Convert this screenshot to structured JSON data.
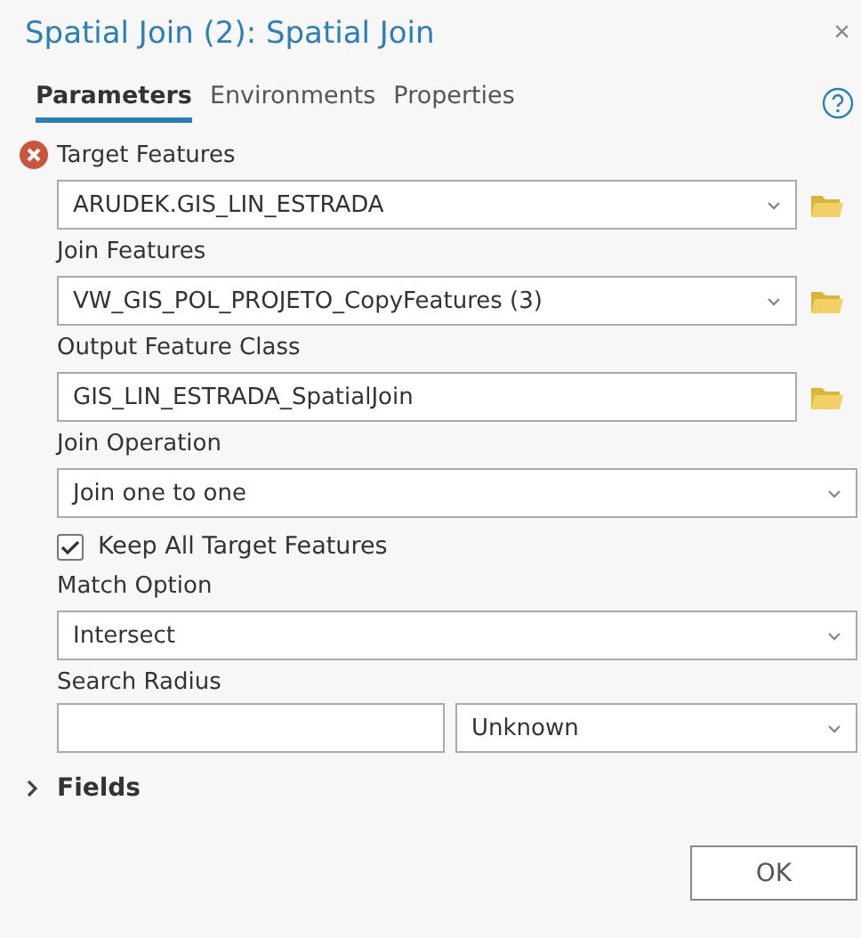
{
  "window": {
    "title": "Spatial Join (2): Spatial Join",
    "close": "×"
  },
  "tabs": [
    {
      "label": "Parameters",
      "selected": true
    },
    {
      "label": "Environments",
      "selected": false
    },
    {
      "label": "Properties",
      "selected": false
    }
  ],
  "params": [
    {
      "kind": "combo",
      "label": "Target Features",
      "value": "ARUDEK.GIS_LIN_ESTRADA",
      "error": true,
      "browse": true
    },
    {
      "kind": "combo",
      "label": "Join Features",
      "value": "VW_GIS_POL_PROJETO_CopyFeatures (3)",
      "browse": true
    },
    {
      "kind": "text",
      "label": "Output Feature Class",
      "value": "GIS_LIN_ESTRADA_SpatialJoin",
      "browse": true
    },
    {
      "kind": "combo",
      "label": "Join Operation",
      "value": "Join one to one",
      "browse": false
    },
    {
      "kind": "checkbox",
      "label": "Keep All Target Features",
      "checked": true
    },
    {
      "kind": "combo",
      "label": "Match Option",
      "value": "Intersect",
      "browse": false
    },
    {
      "kind": "linear",
      "label": "Search Radius",
      "unit": "Unknown"
    }
  ],
  "sections": [
    {
      "label": "Fields",
      "expanded": false
    }
  ],
  "buttons": [
    "OK"
  ]
}
